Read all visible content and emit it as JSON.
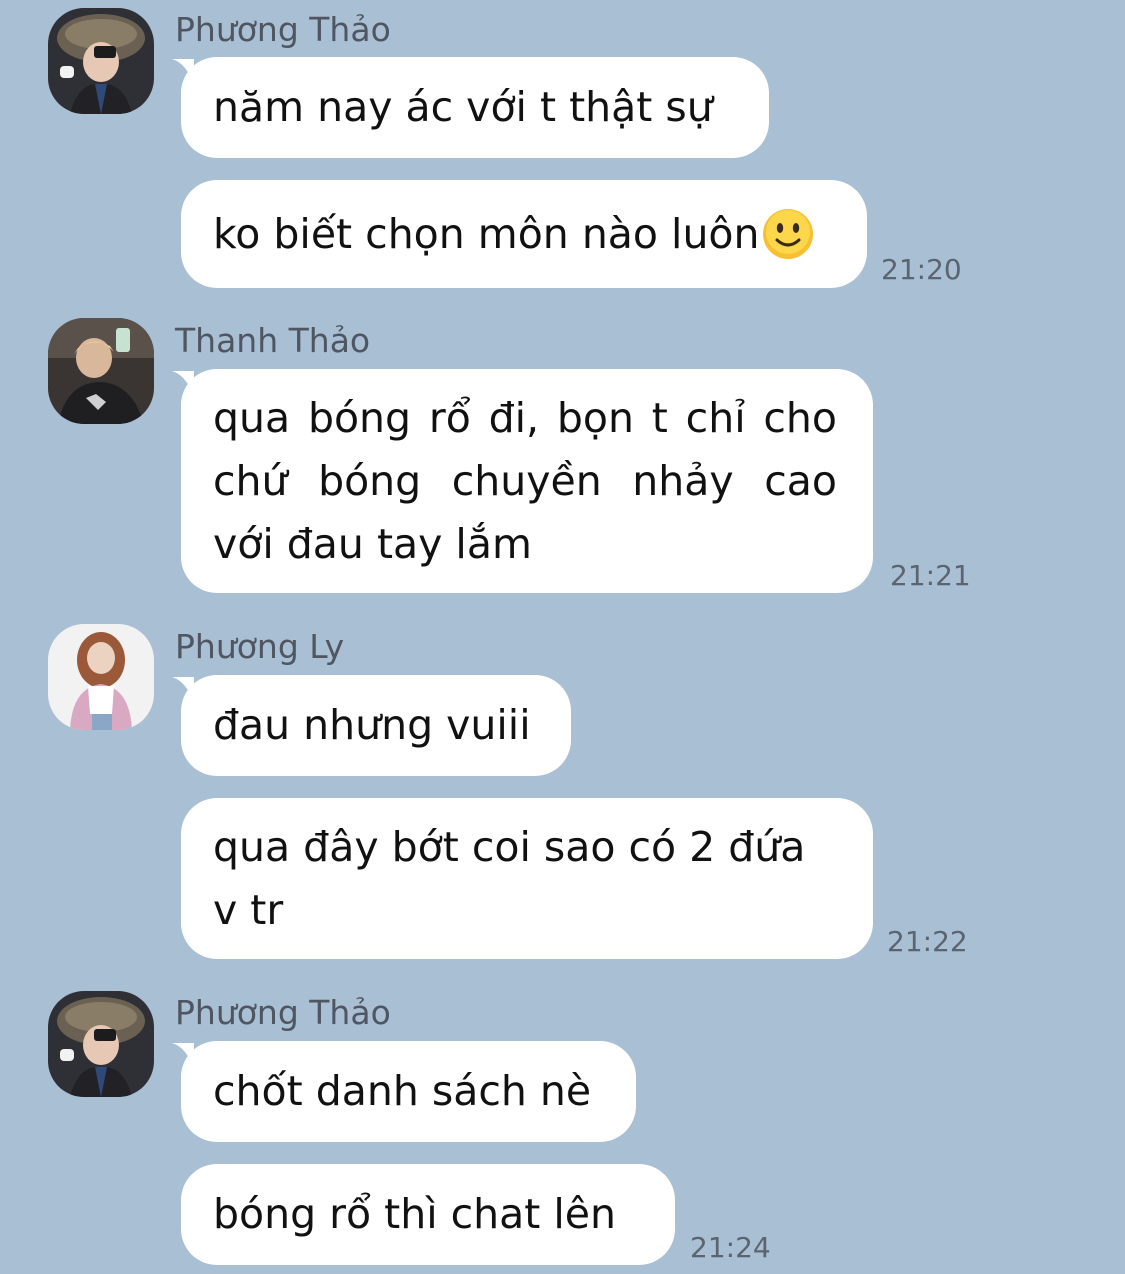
{
  "messages": [
    {
      "sender": "Phương Thảo",
      "bubbles": [
        "năm nay ác với t thật sự",
        "ko biết chọn môn nào luôn"
      ],
      "emoji": "slightly-smiling-face-emoji",
      "time": "21:20"
    },
    {
      "sender": "Thanh Thảo",
      "bubbles": [
        "qua bóng rổ đi, bọn t chỉ cho chứ bóng chuyền nhảy cao với đau tay lắm"
      ],
      "time": "21:21"
    },
    {
      "sender": "Phương Ly",
      "bubbles": [
        "đau nhưng vuiii",
        "qua đây bớt coi sao có 2 đứa v tr"
      ],
      "time": "21:22"
    },
    {
      "sender": "Phương Thảo",
      "bubbles": [
        "chốt danh sách nè",
        "bóng rổ thì chat lên"
      ],
      "time": "21:24"
    }
  ],
  "colors": {
    "background": "#a9bfd3",
    "bubble": "#ffffff",
    "sender_name": "#4f5661",
    "timestamp": "#5b6470",
    "message_text": "#111111"
  }
}
